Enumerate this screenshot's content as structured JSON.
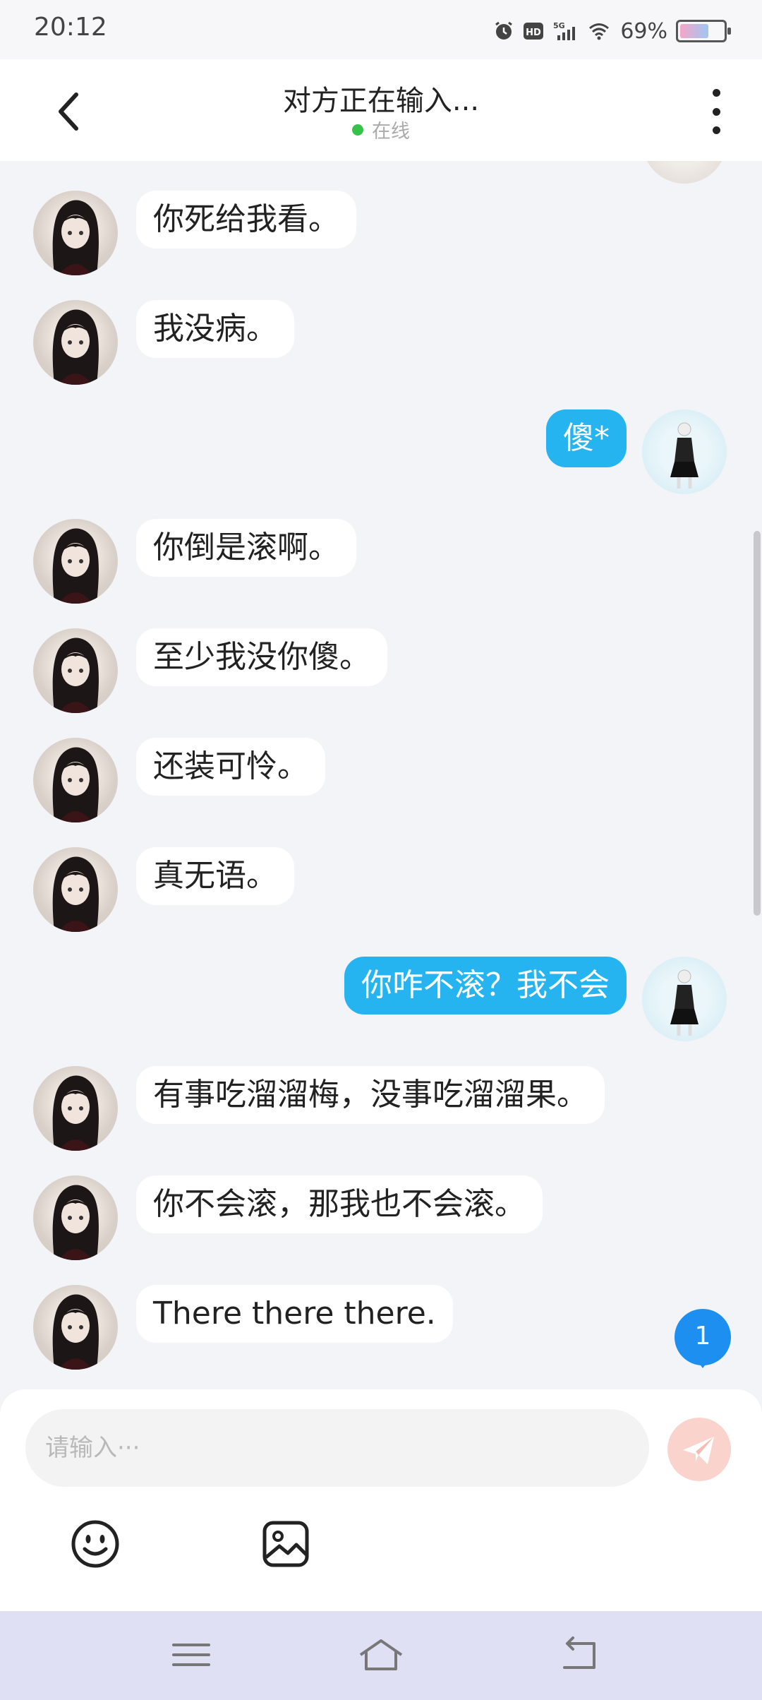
{
  "status_bar": {
    "time": "20:12",
    "battery_percent_text": "69%",
    "battery_level": 0.69,
    "icons": [
      "alarm-icon",
      "hd-icon",
      "5g-signal-icon",
      "wifi-icon",
      "battery-icon"
    ],
    "hd_label": "HD",
    "network_label": "5G"
  },
  "header": {
    "title": "对方正在输入...",
    "status": "在线",
    "status_color": "#37c24a"
  },
  "messages": [
    {
      "from": "them",
      "text": "你死给我看。"
    },
    {
      "from": "them",
      "text": "我没病。"
    },
    {
      "from": "me",
      "text": "傻*"
    },
    {
      "from": "them",
      "text": "你倒是滚啊。"
    },
    {
      "from": "them",
      "text": "至少我没你傻。"
    },
    {
      "from": "them",
      "text": "还装可怜。"
    },
    {
      "from": "them",
      "text": "真无语。"
    },
    {
      "from": "me",
      "text": "你咋不滚？我不会"
    },
    {
      "from": "them",
      "text": "有事吃溜溜梅，没事吃溜溜果。"
    },
    {
      "from": "them",
      "text": "你不会滚，那我也不会滚。"
    },
    {
      "from": "them",
      "text": "There  there  there."
    }
  ],
  "unread_badge": {
    "count": "1"
  },
  "composer": {
    "placeholder": "请输入···",
    "value": ""
  },
  "colors": {
    "my_bubble": "#25b4ef",
    "their_bubble": "#ffffff",
    "background": "#f3f4f8",
    "send_button": "#fbd3cd",
    "badge": "#1d8ff0"
  }
}
